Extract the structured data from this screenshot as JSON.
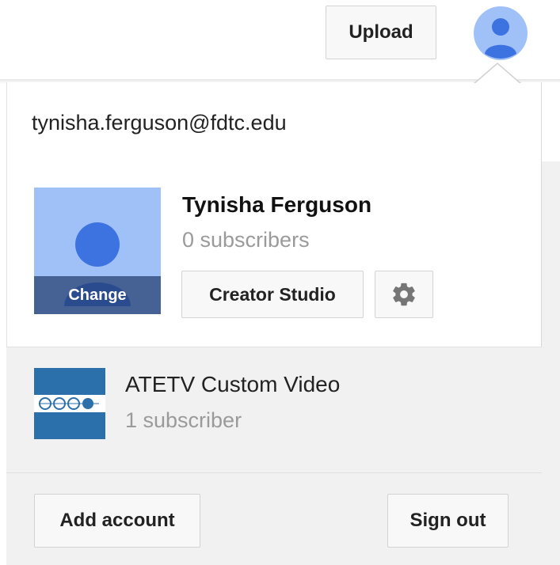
{
  "header": {
    "upload_label": "Upload",
    "account_icon": "account-avatar-icon"
  },
  "account": {
    "email": "tynisha.ferguson@fdtc.edu",
    "channel_name": "Tynisha Ferguson",
    "subscribers": "0 subscribers",
    "change_label": "Change",
    "creator_studio_label": "Creator Studio",
    "settings_icon": "gear-icon"
  },
  "other_accounts": [
    {
      "name": "ATETV Custom Video",
      "subscribers": "1 subscriber",
      "thumbnail_icon": "atetv-logo-thumbnail"
    }
  ],
  "footer": {
    "add_account_label": "Add account",
    "sign_out_label": "Sign out"
  },
  "colors": {
    "avatar_blue": "#3d73e0",
    "avatar_bg": "#a0c0f8",
    "atetv_blue": "#2b6fab"
  }
}
